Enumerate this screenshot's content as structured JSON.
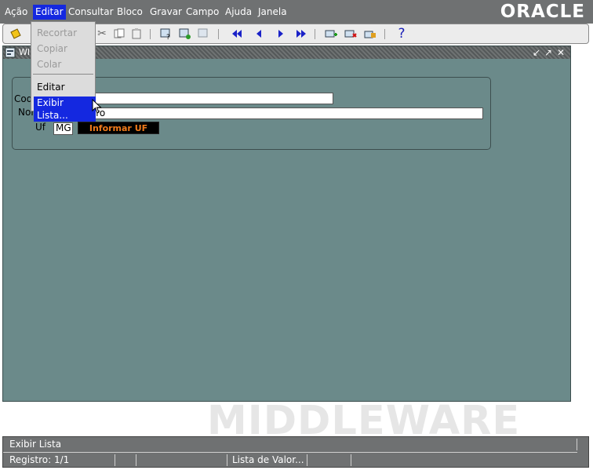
{
  "menu": {
    "items": [
      "Ação",
      "Editar",
      "Consultar",
      "Bloco",
      "Gravar",
      "Campo",
      "Ajuda",
      "Janela"
    ],
    "active": "Editar",
    "logo": "ORACLE"
  },
  "toolbar": {
    "icons": [
      "save-icon",
      "cut-icon",
      "copy-icon",
      "paste-icon",
      "enter-query-icon",
      "execute-query-icon",
      "count-query-icon",
      "first-record-icon",
      "previous-record-icon",
      "next-record-icon",
      "last-record-icon",
      "insert-record-icon",
      "delete-record-icon",
      "lock-record-icon",
      "help-icon"
    ],
    "help_glyph": "?"
  },
  "edit_menu": {
    "recortar": "Recortar",
    "copiar": "Copiar",
    "colar": "Colar",
    "editar": "Editar",
    "exibir_lista": "Exibir Lista..."
  },
  "window": {
    "title": "WI",
    "controls": [
      "↙",
      "↗",
      "✕"
    ]
  },
  "form": {
    "codigo_label": "Cod",
    "nome_label": "Nome",
    "nome_value": "João Pedro",
    "uf_label": "Uf",
    "uf_value": "MG",
    "informar_uf": "Informar UF"
  },
  "watermark": "MIDDLEWARE",
  "status": {
    "message": "Exibir Lista",
    "registro": "Registro: 1/1",
    "lista": "Lista de Valor..."
  },
  "colors": {
    "menubar": "#6f7172",
    "window_bg": "#6b8a8a",
    "highlight": "#1428e0",
    "button_text": "#f07a1a"
  }
}
